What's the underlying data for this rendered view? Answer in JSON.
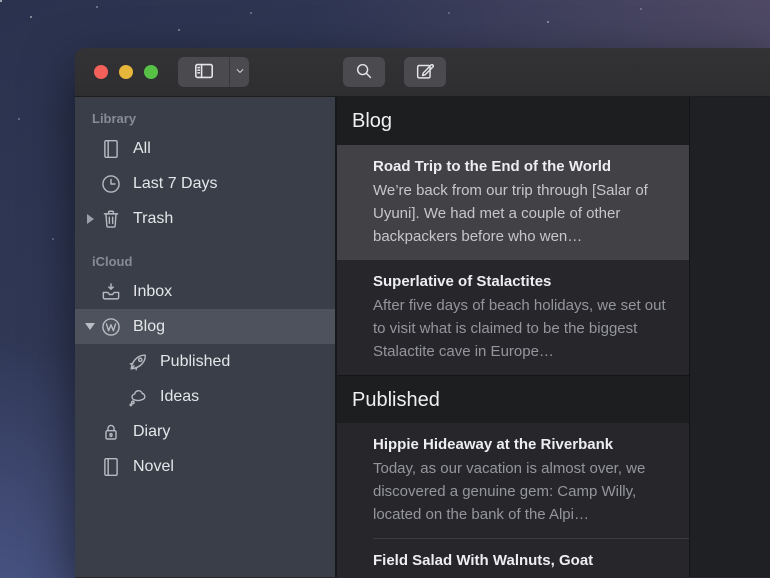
{
  "colors": {
    "traffic_close": "#f4615b",
    "traffic_minimize": "#e9b63c",
    "traffic_zoom": "#57c146",
    "sidebar_background": "#3a3e48",
    "sidebar_selection": "#4d525c",
    "list_selection": "#424146",
    "section_header_background": "#1d1e20"
  },
  "toolbar": {
    "buttons": [
      {
        "name": "sidebar-toggle",
        "icon": "sidebar-panel-icon"
      },
      {
        "name": "sidebar-options",
        "icon": "chevron-down-icon"
      },
      {
        "name": "search",
        "icon": "search-icon"
      },
      {
        "name": "compose",
        "icon": "compose-icon"
      }
    ]
  },
  "sidebar": {
    "sections": [
      {
        "label": "Library",
        "items": [
          {
            "label": "All",
            "icon": "book-icon"
          },
          {
            "label": "Last 7 Days",
            "icon": "clock-icon"
          },
          {
            "label": "Trash",
            "icon": "trash-icon",
            "disclosure": "collapsed"
          }
        ]
      },
      {
        "label": "iCloud",
        "items": [
          {
            "label": "Inbox",
            "icon": "inbox-icon"
          },
          {
            "label": "Blog",
            "icon": "wordpress-icon",
            "disclosure": "expanded",
            "selected": true
          },
          {
            "label": "Published",
            "icon": "rocket-icon",
            "indent": 2
          },
          {
            "label": "Ideas",
            "icon": "thought-cloud-icon",
            "indent": 2
          },
          {
            "label": "Diary",
            "icon": "lock-icon"
          },
          {
            "label": "Novel",
            "icon": "book-icon"
          }
        ]
      }
    ]
  },
  "list": {
    "groups": [
      {
        "header": "Blog",
        "entries": [
          {
            "title": "Road Trip to the End of the World",
            "preview": "We’re back from our trip through [Salar of Uyuni]. We had met a couple of other backpackers before who wen…",
            "selected": true
          },
          {
            "title": "Superlative of Stalactites",
            "preview": "After five days of beach holidays, we set out to visit what is claimed to be the biggest Stalactite cave in Europe…"
          }
        ]
      },
      {
        "header": "Published",
        "entries": [
          {
            "title": "Hippie Hideaway at the Riverbank",
            "preview": "Today, as our vacation is almost over, we discovered a genuine gem: Camp Willy, located on the bank of the Alpi…"
          },
          {
            "title": "Field Salad With Walnuts, Goat",
            "preview": ""
          }
        ]
      }
    ]
  }
}
